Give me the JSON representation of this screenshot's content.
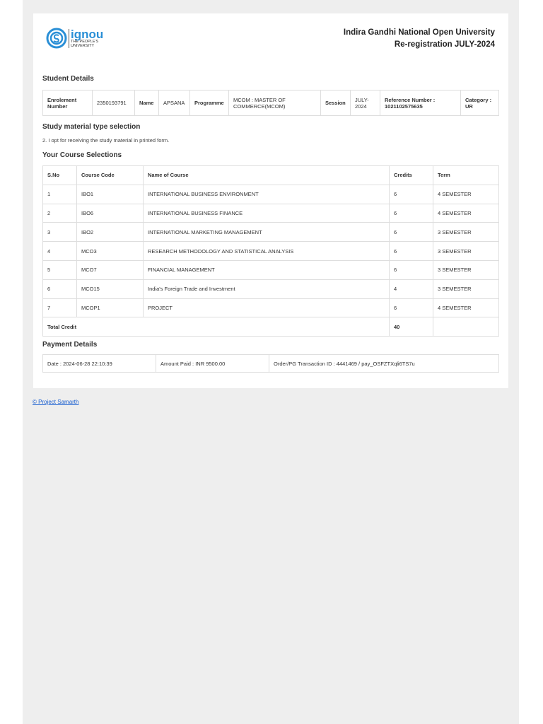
{
  "header": {
    "logo_brand": "ignou",
    "logo_tagline_1": "THE PEOPLE'S",
    "logo_tagline_2": "UNIVERSITY",
    "university": "Indira Gandhi National Open University",
    "subtitle": "Re-registration JULY-2024",
    "accent": "#2a8fd6"
  },
  "student": {
    "title": "Student Details",
    "enrol_label": "Enrolement Number",
    "enrol": "2350193791",
    "name_label": "Name",
    "name": "APSANA",
    "programme_label": "Programme",
    "programme": "MCOM : MASTER OF COMMERCE(MCOM)",
    "session_label": "Session",
    "session": "JULY-2024",
    "reference": "Reference Number : 1021102575635",
    "category": "Category : UR"
  },
  "study": {
    "title": "Study material type selection",
    "text": "2. I opt for receiving the study material in printed form."
  },
  "courses": {
    "title": "Your Course Selections",
    "headers": [
      "S.No",
      "Course Code",
      "Name of Course",
      "Credits",
      "Term"
    ],
    "rows": [
      [
        "1",
        "IBO1",
        "INTERNATIONAL BUSINESS ENVIRONMENT",
        "6",
        "4 SEMESTER"
      ],
      [
        "2",
        "IBO6",
        "INTERNATIONAL BUSINESS FINANCE",
        "6",
        "4 SEMESTER"
      ],
      [
        "3",
        "IBO2",
        "INTERNATIONAL MARKETING MANAGEMENT",
        "6",
        "3 SEMESTER"
      ],
      [
        "4",
        "MCO3",
        "RESEARCH METHODOLOGY AND STATISTICAL ANALYSIS",
        "6",
        "3 SEMESTER"
      ],
      [
        "5",
        "MCO7",
        "FINANCIAL MANAGEMENT",
        "6",
        "3 SEMESTER"
      ],
      [
        "6",
        "MCO15",
        "India's Foreign Trade and Investment",
        "4",
        "3 SEMESTER"
      ],
      [
        "7",
        "MCOP1",
        "PROJECT",
        "6",
        "4 SEMESTER"
      ]
    ],
    "total_label": "Total Credit",
    "total": "40"
  },
  "payment": {
    "title": "Payment Details",
    "date": "Date : 2024-06-28 22:10:39",
    "amount": "Amount Paid : INR 9500.00",
    "transaction": "Order/PG Transaction ID : 4441469 / pay_OSFZTXqli6TS7u"
  },
  "footer": {
    "link": "© Project Samarth"
  }
}
